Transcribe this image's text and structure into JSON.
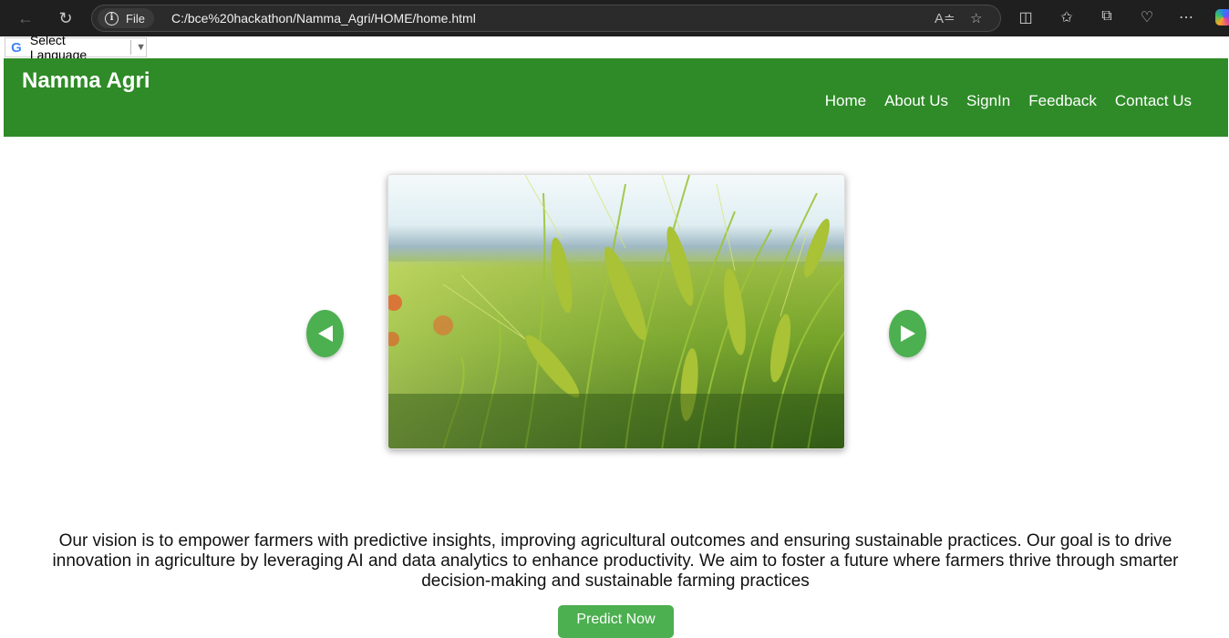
{
  "browser": {
    "file_chip": "File",
    "url": "C:/bce%20hackathon/Namma_Agri/HOME/home.html",
    "icons": [
      "back-icon",
      "reload-icon",
      "info-icon",
      "read-aloud-icon",
      "favorite-star-icon",
      "split-screen-icon",
      "favorites-icon",
      "collections-icon",
      "browser-essentials-icon",
      "more-icon",
      "copilot-icon"
    ]
  },
  "translate": {
    "label": "Select Language"
  },
  "header": {
    "brand": "Namma Agri",
    "nav": [
      "Home",
      "About Us",
      "SignIn",
      "Feedback",
      "Contact Us"
    ]
  },
  "carousel": {
    "prev_icon": "triangle-left-icon",
    "next_icon": "triangle-right-icon"
  },
  "vision": {
    "text": "Our vision is to empower farmers with predictive insights, improving agricultural outcomes and ensuring sustainable practices. Our goal is to drive innovation in agriculture by leveraging AI and data analytics to enhance productivity. We aim to foster a future where farmers thrive through smarter decision-making and sustainable farming practices"
  },
  "cta": {
    "label": "Predict Now"
  },
  "colors": {
    "header_bg": "#2e8b27",
    "accent": "#4caf50",
    "chrome_bg": "#1f1f1f"
  }
}
